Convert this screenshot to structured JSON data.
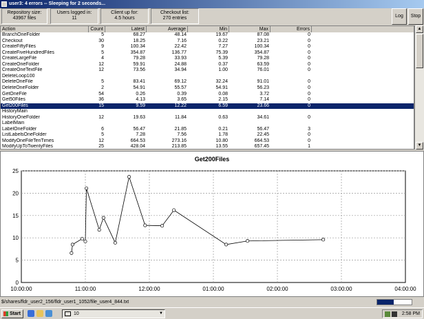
{
  "window": {
    "title": "user3: 4 errors -- Sleeping for 2 seconds..."
  },
  "stats": [
    {
      "label": "Repository size:",
      "value": "43967 files"
    },
    {
      "label": "Users logged in:",
      "value": "11"
    },
    {
      "label": "Client up for:",
      "value": "4.5 hours"
    },
    {
      "label": "Checkout list:",
      "value": "270 entries"
    }
  ],
  "buttons": {
    "log": "Log",
    "stop": "Stop"
  },
  "table": {
    "columns": [
      "Action",
      "Count",
      "Latest",
      "Average",
      "Min",
      "Max",
      "Errors"
    ],
    "rows": [
      [
        "BranchOneFolder",
        "5",
        "68.27",
        "48.14",
        "19.67",
        "87.08",
        "0"
      ],
      [
        "Checkout",
        "30",
        "18.25",
        "7.16",
        "0.22",
        "23.21",
        "0"
      ],
      [
        "CreateFiftyFiles",
        "9",
        "100.34",
        "22.42",
        "7.27",
        "100.34",
        "0"
      ],
      [
        "CreateFiveHundredFiles",
        "5",
        "354.87",
        "136.77",
        "75.39",
        "354.87",
        "0"
      ],
      [
        "CreateLargeFile",
        "4",
        "79.28",
        "33.93",
        "5.39",
        "79.28",
        "0"
      ],
      [
        "CreateOneFolder",
        "12",
        "59.91",
        "24.88",
        "0.37",
        "63.59",
        "0"
      ],
      [
        "CreateOneTextFile",
        "12",
        "73.56",
        "34.94",
        "1.00",
        "76.01",
        "0"
      ],
      [
        "DeleteLoop100",
        "",
        "",
        "",
        "",
        "",
        ""
      ],
      [
        "DeleteOneFile",
        "5",
        "83.41",
        "69.12",
        "32.24",
        "91.01",
        "0"
      ],
      [
        "DeleteOneFolder",
        "2",
        "54.91",
        "55.57",
        "54.91",
        "56.23",
        "0"
      ],
      [
        "GetOneFile",
        "54",
        "0.26",
        "0.39",
        "0.08",
        "3.72",
        "0"
      ],
      [
        "Get50Files",
        "36",
        "4.13",
        "3.65",
        "2.15",
        "7.14",
        "0"
      ],
      [
        "Get200Files",
        "15",
        "9.59",
        "12.22",
        "6.59",
        "23.66",
        "0"
      ],
      [
        "HistoryMain",
        "",
        "",
        "",
        "",
        "",
        ""
      ],
      [
        "HistoryOneFolder",
        "12",
        "19.63",
        "11.84",
        "0.63",
        "34.61",
        "0"
      ],
      [
        "LabelMain",
        "",
        "",
        "",
        "",
        "",
        ""
      ],
      [
        "LabelOneFolder",
        "6",
        "56.47",
        "21.85",
        "0.21",
        "56.47",
        "3"
      ],
      [
        "ListLabelsOneFolder",
        "5",
        "7.28",
        "7.56",
        "1.78",
        "22.45",
        "0"
      ],
      [
        "ModifyOneFileTenTimes",
        "12",
        "664.53",
        "273.16",
        "10.80",
        "664.53",
        "0"
      ],
      [
        "ModifyUpToTwentyFiles",
        "25",
        "428.04",
        "213.85",
        "13.55",
        "657.45",
        "1"
      ]
    ],
    "selected_row": 12
  },
  "chart_data": {
    "type": "line",
    "title": "Get200Files",
    "xlabel": "",
    "ylabel": "",
    "x_ticks": [
      "10:00:00",
      "11:00:00",
      "12:00:00",
      "01:00:00",
      "02:00:00",
      "03:00:00",
      "04:00:00"
    ],
    "y_ticks": [
      "0",
      "5",
      "10",
      "15",
      "20",
      "25"
    ],
    "ylim": [
      0,
      25
    ],
    "x": [
      "10:47",
      "10:48",
      "10:57",
      "11:00",
      "11:01",
      "11:13",
      "11:17",
      "11:28",
      "11:41",
      "11:56",
      "12:12",
      "12:23",
      "01:12",
      "01:32",
      "02:43"
    ],
    "values": [
      6.59,
      8.5,
      9.8,
      9.2,
      21.1,
      11.8,
      14.5,
      8.9,
      23.66,
      12.8,
      12.7,
      16.2,
      8.5,
      9.3,
      9.59
    ],
    "grid": true,
    "legend": "none"
  },
  "status": {
    "path": "$/shares/fldr_user2_156/fldr_user1_1052/file_user4_844.txt",
    "progress_pct": 48,
    "progress_text": "48 %"
  },
  "taskbar": {
    "start_label": "Start",
    "task_label": "10",
    "clock": "2:58 PM"
  },
  "icons": {
    "start": "windows-logo-icon",
    "ie": "ie-icon",
    "folder": "folder-icon",
    "explorer": "explorer-icon"
  }
}
